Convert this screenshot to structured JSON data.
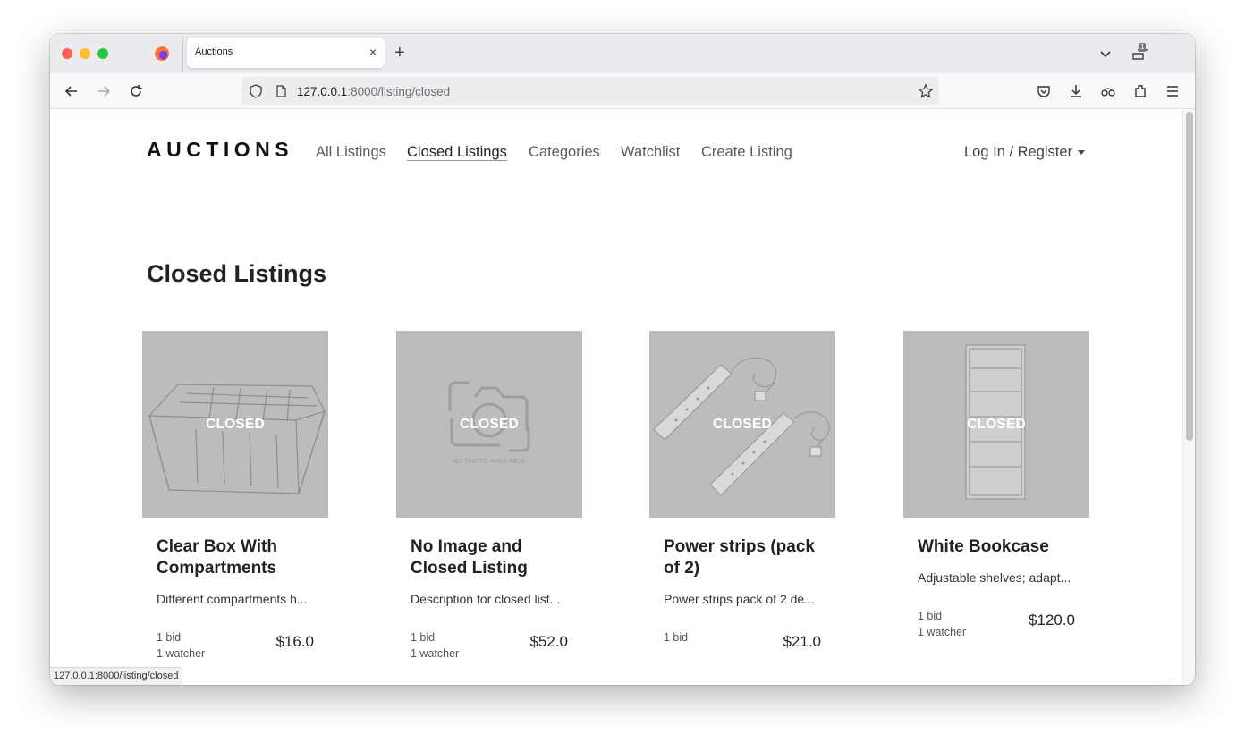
{
  "browser": {
    "tab_title": "Auctions",
    "tab_close": "×",
    "new_tab": "+",
    "tab_count": "1",
    "url_host": "127.0.0.1",
    "url_rest": ":8000/listing/closed",
    "status_url": "127.0.0.1:8000/listing/closed"
  },
  "site": {
    "brand": "AUCTIONS",
    "nav": [
      {
        "label": "All Listings"
      },
      {
        "label": "Closed Listings"
      },
      {
        "label": "Categories"
      },
      {
        "label": "Watchlist"
      },
      {
        "label": "Create Listing"
      }
    ],
    "login": "Log In / Register"
  },
  "page": {
    "title": "Closed Listings"
  },
  "listings": [
    {
      "title": "Clear Box With Compartments",
      "desc": "Different compartments h...",
      "bids": "1 bid",
      "watchers": "1 watcher",
      "price": "$16.0",
      "overlay": "CLOSED"
    },
    {
      "title": "No Image and Closed Listing",
      "desc": "Description for closed list...",
      "bids": "1 bid",
      "watchers": "1 watcher",
      "price": "$52.0",
      "overlay": "CLOSED",
      "placeholder": "NO PHOTO AVAILABLE"
    },
    {
      "title": "Power strips (pack of 2)",
      "desc": "Power strips pack of 2 de...",
      "bids": "1 bid",
      "watchers": "",
      "price": "$21.0",
      "overlay": "CLOSED"
    },
    {
      "title": "White Bookcase",
      "desc": "Adjustable shelves; adapt...",
      "bids": "1 bid",
      "watchers": "1 watcher",
      "price": "$120.0",
      "overlay": "CLOSED"
    }
  ]
}
